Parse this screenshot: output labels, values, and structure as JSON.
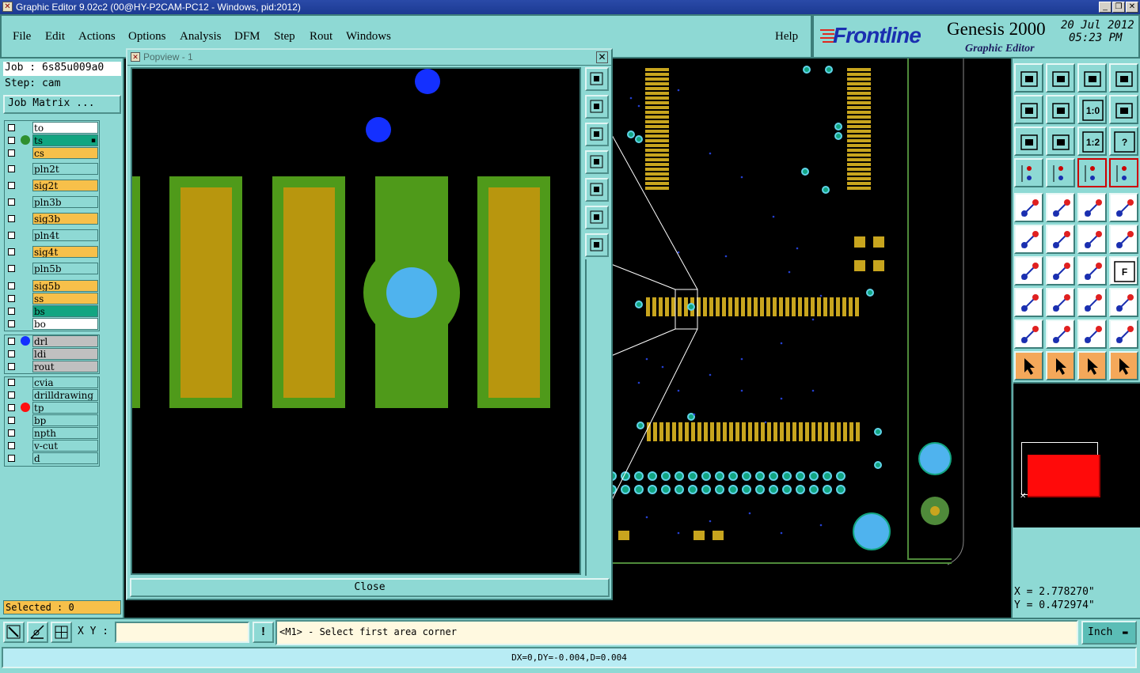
{
  "window": {
    "title": "Graphic Editor 9.02c2 (00@HY-P2CAM-PC12 - Windows, pid:2012)",
    "controls": {
      "minimize": "_",
      "maximize": "❐",
      "close": "✕"
    }
  },
  "menu": {
    "items": [
      "File",
      "Edit",
      "Actions",
      "Options",
      "Analysis",
      "DFM",
      "Step",
      "Rout",
      "Windows"
    ],
    "help": "Help"
  },
  "brand": {
    "logo": "Frontline",
    "product": "Genesis 2000",
    "subtitle": "Graphic Editor",
    "date": "20 Jul 2012",
    "time": "05:23 PM"
  },
  "job": {
    "job_label": "Job : 6s85u009a0",
    "step_label": "Step: cam",
    "matrix_button": "Job Matrix ..."
  },
  "layers": [
    {
      "name": "to",
      "color": "#ffffff"
    },
    {
      "name": "ts",
      "color": "#12a581",
      "indicator": "#2f8f2f",
      "affected": true
    },
    {
      "name": "cs",
      "color": "#f7c04a"
    },
    {
      "name": "pln2t",
      "color": "#8ed9d4"
    },
    {
      "name": "sig2t",
      "color": "#f7c04a"
    },
    {
      "name": "pln3b",
      "color": "#8ed9d4"
    },
    {
      "name": "sig3b",
      "color": "#f7c04a"
    },
    {
      "name": "pln4t",
      "color": "#8ed9d4"
    },
    {
      "name": "sig4t",
      "color": "#f7c04a"
    },
    {
      "name": "pln5b",
      "color": "#8ed9d4"
    },
    {
      "name": "sig5b",
      "color": "#f7c04a"
    },
    {
      "name": "ss",
      "color": "#f7c04a"
    },
    {
      "name": "bs",
      "color": "#12a581"
    },
    {
      "name": "bo",
      "color": "#ffffff"
    },
    {
      "name": "drl",
      "color": "#c0c0c0",
      "indicator": "#1430ff"
    },
    {
      "name": "ldi",
      "color": "#c0c0c0"
    },
    {
      "name": "rout",
      "color": "#c0c0c0"
    },
    {
      "name": "cvia",
      "color": "#8ed9d4"
    },
    {
      "name": "drilldrawing",
      "color": "#8ed9d4"
    },
    {
      "name": "tp",
      "color": "#8ed9d4",
      "indicator": "#ff1010"
    },
    {
      "name": "bp",
      "color": "#8ed9d4"
    },
    {
      "name": "npth",
      "color": "#8ed9d4"
    },
    {
      "name": "v-cut",
      "color": "#8ed9d4"
    },
    {
      "name": "d",
      "color": "#8ed9d4"
    }
  ],
  "selected": "Selected : 0",
  "popview": {
    "title": "Popview - 1",
    "close_label": "Close"
  },
  "coords": {
    "x": "X = 2.778270\"",
    "y": "Y = 0.472974\""
  },
  "command": {
    "xy_label": "X Y :",
    "xy_value": "",
    "message": "<M1> - Select first area corner",
    "units": "Inch"
  },
  "status": {
    "measure": "DX=0,DY=-0.004,D=0.004"
  },
  "toolbar_icons": [
    [
      "move-up-layer-icon",
      "move-down-layer-icon",
      "home-icon",
      "split-view-icon"
    ],
    [
      "pan-left-icon",
      "pan-right-icon",
      "zoom-1-0-icon",
      "s-curve-icon"
    ],
    [
      "zoom-fit-icon",
      "zoom-center-icon",
      "zoom-1-2-icon",
      "help-icon"
    ],
    [
      "measure-tool-icon",
      "grid-icon",
      "snap-pad-icon",
      "snap-pad-active-icon"
    ],
    [
      "add-feature-icon",
      "draw-line-icon",
      "ruler-icon",
      "select-pad-icon"
    ],
    [
      "connect-pads-icon",
      "delete-feature-icon",
      "line-to-pad-icon",
      "pad-to-line-icon"
    ],
    [
      "angle-icon",
      "slant-line-icon",
      "arc-icon",
      "text-icon"
    ],
    [
      "move-pad-icon",
      "split-line-icon",
      "stretch-icon",
      "copy-pad-icon"
    ],
    [
      "triangle-select-icon",
      "triangle-up-icon",
      "triangle-bar-icon",
      "triangle-outline-icon"
    ],
    [
      "pointer-icon",
      "select-box-icon",
      "select-arrow-icon",
      "route-icon"
    ]
  ]
}
